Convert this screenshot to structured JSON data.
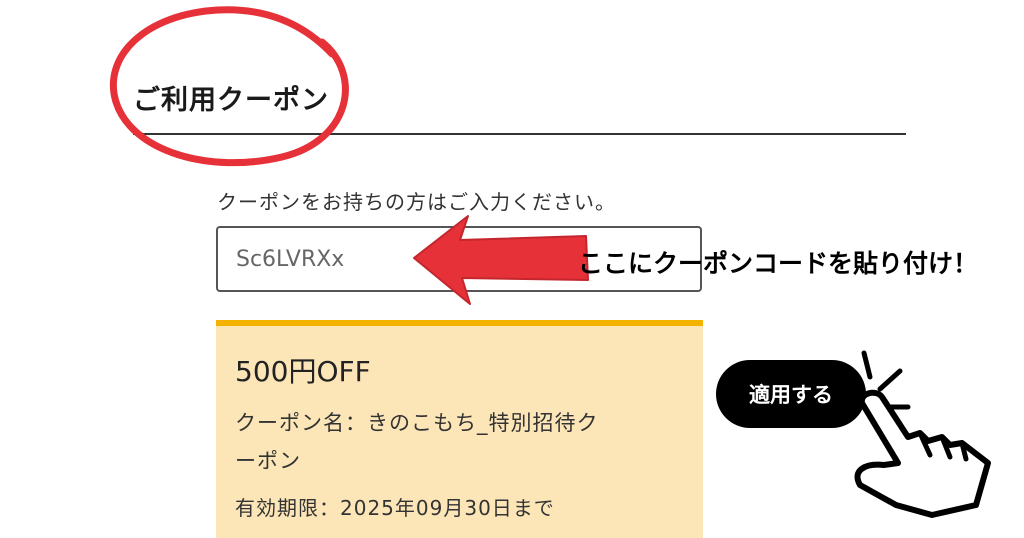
{
  "section": {
    "title": "ご利用クーポン"
  },
  "coupon_form": {
    "instruction": "クーポンをお持ちの方はご入力ください。",
    "input_value": "Sc6LVRXx",
    "apply_label": "適用する"
  },
  "annotation": {
    "paste_note": "ここにクーポンコードを貼り付け！",
    "arrow_color": "#e63138",
    "circle_color": "#e63138"
  },
  "coupon_card": {
    "amount": "500円OFF",
    "name_line1": "クーポン名：きのこもち_特別招待ク",
    "name_line2": "ーポン",
    "expiry": "有効期限：2025年09月30日まで"
  },
  "colors": {
    "card_background": "#fce6b8",
    "card_accent": "#f3b300",
    "button_background": "#000000"
  }
}
